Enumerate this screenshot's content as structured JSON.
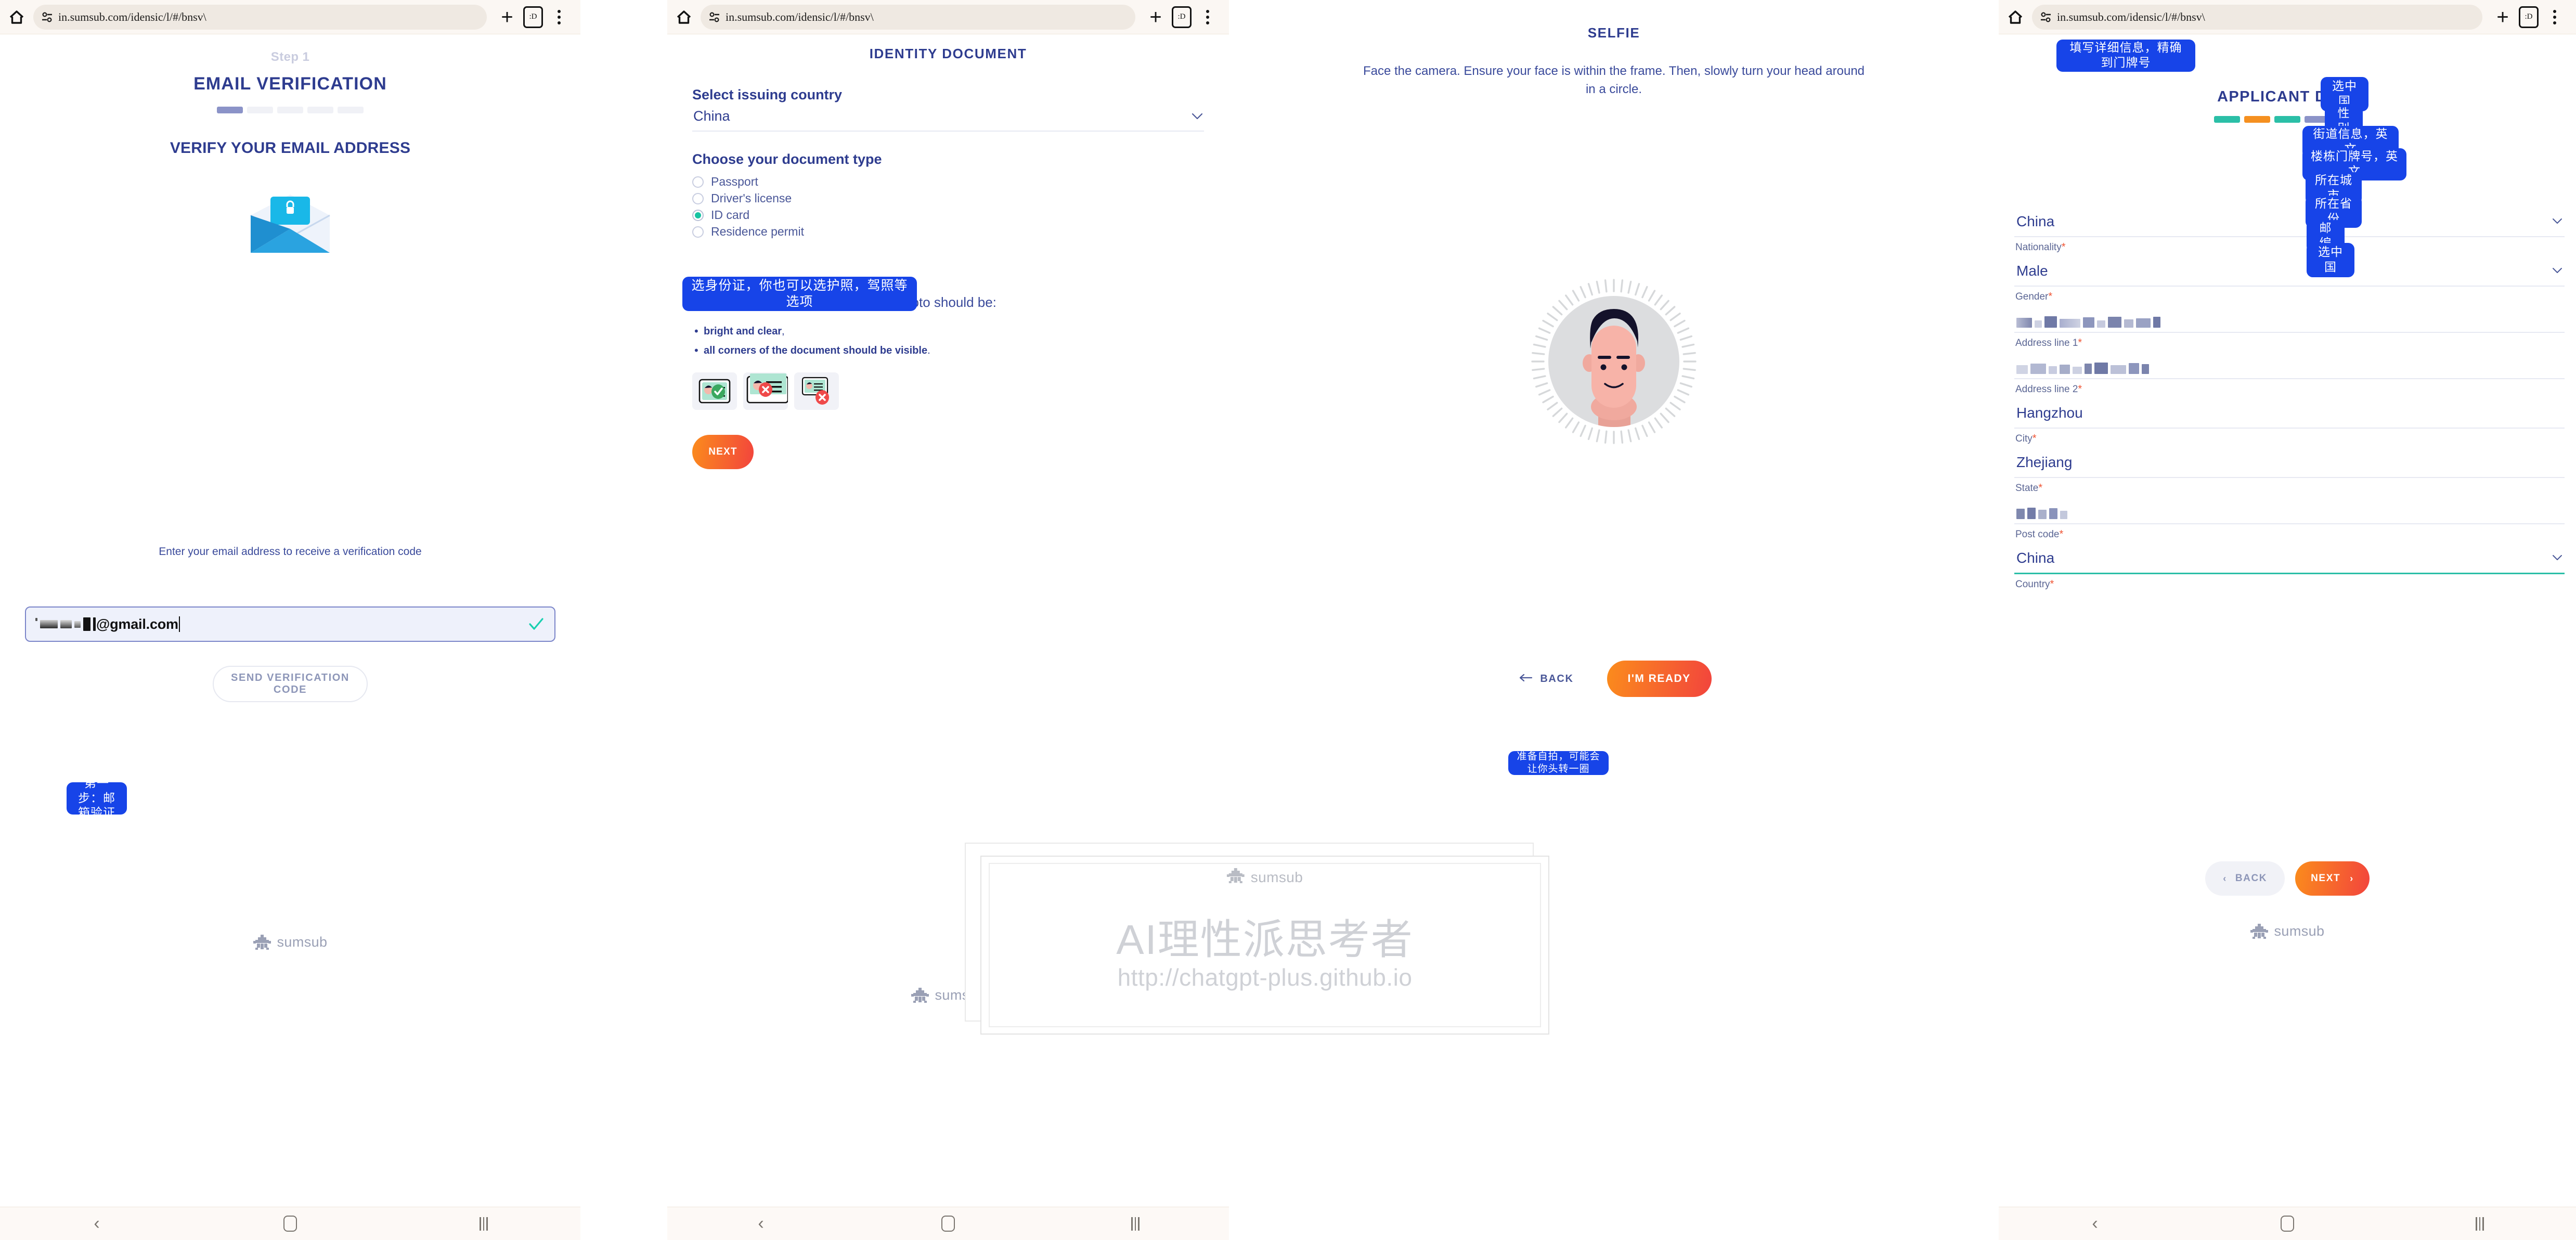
{
  "browser": {
    "url": "in.sumsub.com/idensic/l/#/bnsv\\",
    "home_icon": "home-icon",
    "site_settings_icon": "site-settings-icon",
    "new_tab_label": "+",
    "tab_count_label": ":D",
    "menu_icon": "kebab-menu-icon",
    "nav_back_icon": "nav-back-icon",
    "nav_home_icon": "nav-home-icon",
    "nav_recents_icon": "nav-recents-icon"
  },
  "brand": {
    "name": "sumsub",
    "accent_blue": "#2e3c8f",
    "accent_orange": "#f2443d",
    "accent_teal": "#17c3a2",
    "chip_blue": "#1744e8"
  },
  "panel1": {
    "step_label": "Step 1",
    "title": "EMAIL VERIFICATION",
    "progress_segments": 5,
    "progress_active": 1,
    "progress_active_color": "#8b93c8",
    "section_title": "VERIFY YOUR EMAIL ADDRESS",
    "envelope_icon": "envelope-lock-icon",
    "instruction": "Enter your email address to receive a verification code",
    "email_value": "@gmail.com",
    "email_masked_note": "masked-local-part",
    "valid_icon": "check-icon",
    "send_code_label": "SEND VERIFICATION CODE",
    "annotation": "第一步：邮箱验证",
    "footer_brand": "sumsub"
  },
  "panel2": {
    "title": "IDENTITY DOCUMENT",
    "country_label": "Select issuing country",
    "country_value": "China",
    "doc_type_label": "Choose your document type",
    "doc_options": [
      {
        "label": "Passport",
        "selected": false
      },
      {
        "label": "Driver's license",
        "selected": false
      },
      {
        "label": "ID card",
        "selected": true
      },
      {
        "label": "Residence permit",
        "selected": false
      }
    ],
    "annotation": "选身份证，你也可以选护照，驾照等选项",
    "instruction": "Take a photo of your ID card. The photo should be:",
    "bullets": [
      {
        "bold": "bright and clear",
        "tail": ","
      },
      {
        "bold": "all corners of the document should be visible",
        "tail": "."
      }
    ],
    "examples": [
      {
        "name": "good-example",
        "state": "ok"
      },
      {
        "name": "cropped-example",
        "state": "bad"
      },
      {
        "name": "too-small-example",
        "state": "bad"
      }
    ],
    "next_label": "NEXT",
    "footer_brand": "sumsub"
  },
  "panel3": {
    "title": "SELFIE",
    "instruction": "Face the camera. Ensure your face is within the frame. Then, slowly turn your head around in a circle.",
    "avatar_icon": "avatar-face-icon",
    "back_label": "BACK",
    "ready_label": "I'M READY",
    "annotation": "准备自拍，可能会让你头转一圈"
  },
  "panel4": {
    "annotation_top": "填写详细信息，精确到门牌号",
    "title": "APPLICANT DATA",
    "progress_segments": [
      {
        "color": "#2bbfa7"
      },
      {
        "color": "#f59020"
      },
      {
        "color": "#2bbfa7"
      },
      {
        "color": "#8b93c8"
      },
      {
        "color": "#f0f1f6"
      }
    ],
    "fields": [
      {
        "value": "China",
        "label": "Nationality",
        "required": true,
        "dropdown": true,
        "masked": false,
        "underline": "normal",
        "annotation": "选中国"
      },
      {
        "value": "Male",
        "label": "Gender",
        "required": true,
        "dropdown": true,
        "masked": false,
        "underline": "normal",
        "annotation": "性别"
      },
      {
        "value": "",
        "label": "Address line 1",
        "required": true,
        "dropdown": false,
        "masked": true,
        "underline": "normal",
        "annotation": "街道信息，英文"
      },
      {
        "value": "",
        "label": "Address line 2",
        "required": true,
        "dropdown": false,
        "masked": true,
        "underline": "normal",
        "annotation": "楼栋门牌号，英文"
      },
      {
        "value": "Hangzhou",
        "label": "City",
        "required": true,
        "dropdown": false,
        "masked": false,
        "underline": "normal",
        "annotation": "所在城市"
      },
      {
        "value": "Zhejiang",
        "label": "State",
        "required": true,
        "dropdown": false,
        "masked": false,
        "underline": "normal",
        "annotation": "所在省份"
      },
      {
        "value": "",
        "label": "Post code",
        "required": true,
        "dropdown": false,
        "masked": true,
        "underline": "normal",
        "annotation": "邮编"
      },
      {
        "value": "China",
        "label": "Country",
        "required": true,
        "dropdown": true,
        "masked": false,
        "underline": "teal",
        "annotation": "选中国"
      }
    ],
    "back_label": "BACK",
    "next_label": "NEXT",
    "footer_brand": "sumsub"
  },
  "watermark": {
    "brand": "sumsub",
    "main_text": "AI理性派思考者",
    "url_text": "http://chatgpt-plus.github.io"
  }
}
